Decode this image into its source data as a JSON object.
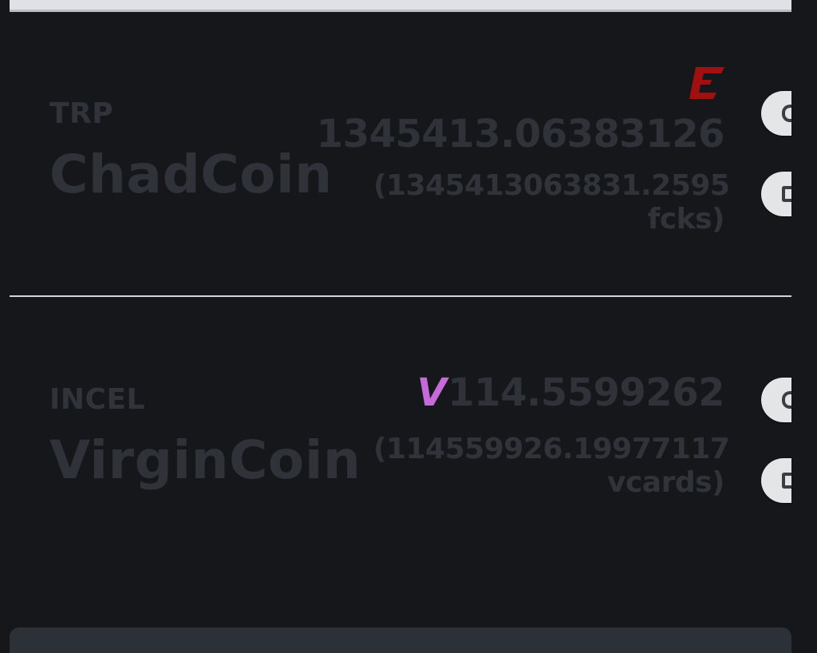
{
  "coins": [
    {
      "ticker": "TRP",
      "name": "ChadCoin",
      "symbol_icon": "chadcoin-symbol-icon",
      "symbol_color": "#a11010",
      "amount": "1345413.06383126",
      "converted_line1": "(1345413063831.2595",
      "converted_line2": "fcks)"
    },
    {
      "ticker": "INCEL",
      "name": "VirginCoin",
      "symbol_icon": "virgincoin-symbol-icon",
      "symbol": "V",
      "symbol_color": "#c56ad9",
      "amount": "114.5599262",
      "converted_line1": "(114559926.19977117",
      "converted_line2": "vcards)"
    }
  ],
  "colors": {
    "background": "#16171a",
    "text_dim": "#2f3339",
    "divider": "#d3d5d8",
    "card": "#2c3138"
  }
}
